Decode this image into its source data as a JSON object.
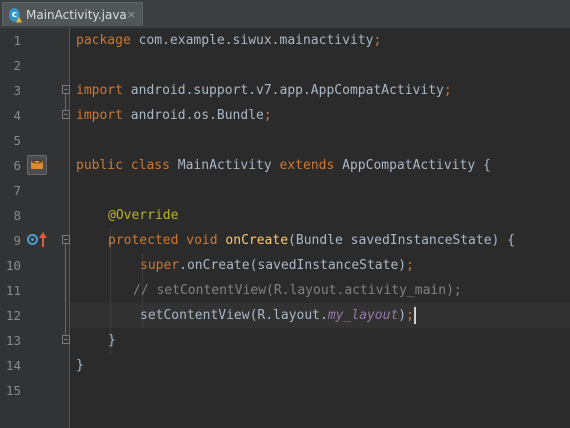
{
  "tab": {
    "title": "MainActivity.java",
    "close": "×",
    "icon_letter": "c"
  },
  "gutter": {
    "line_numbers": [
      "1",
      "2",
      "3",
      "4",
      "5",
      "6",
      "7",
      "8",
      "9",
      "10",
      "11",
      "12",
      "13",
      "14",
      "15"
    ]
  },
  "code": {
    "l1": {
      "kw": "package",
      "rest": " com.example.siwux.mainactivity",
      "semi": ";"
    },
    "l3": {
      "kw": "import",
      "rest": " android.support.v7.app.AppCompatActivity",
      "semi": ";"
    },
    "l4": {
      "kw": "import",
      "rest": " android.os.Bundle",
      "semi": ";"
    },
    "l6": {
      "kw1": "public",
      "kw2": "class",
      "name": "MainActivity",
      "kw3": "extends",
      "parent": "AppCompatActivity",
      "brace": "{"
    },
    "l8": {
      "annotation": "@Override"
    },
    "l9": {
      "kw1": "protected",
      "kw2": "void",
      "method": "onCreate",
      "params": "(Bundle savedInstanceState) {"
    },
    "l10": {
      "kw": "super",
      "rest": ".onCreate(savedInstanceState)",
      "semi": ";"
    },
    "l11": {
      "comment": "// setContentView(R.layout.activity_main);"
    },
    "l12": {
      "call": "setContentView(R.layout.",
      "field": "my_layout",
      "close": ")",
      "semi": ";"
    },
    "l13": {
      "brace": "}"
    },
    "l14": {
      "brace": "}"
    }
  },
  "colors": {
    "background": "#2b2b2b",
    "keyword": "#cc7832",
    "annotation": "#bbb529",
    "method": "#ffc66d",
    "comment": "#808080",
    "field": "#9876aa",
    "text": "#a9b7c6"
  }
}
